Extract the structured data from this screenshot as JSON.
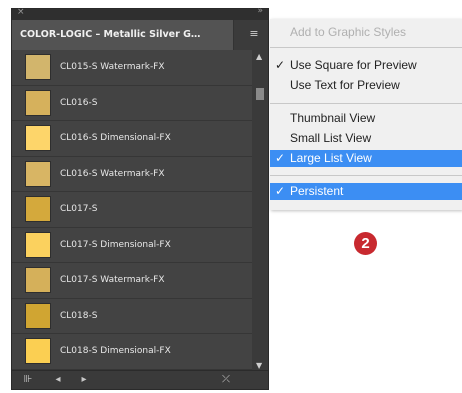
{
  "panel": {
    "close_glyph": "×",
    "collapse_glyph": "»",
    "tab_title": "COLOR-LOGIC – Metallic Silver G…",
    "menu_glyph": "≡",
    "items": [
      {
        "swatch_color": "#d2b56c",
        "label": "CL015-S   Watermark-FX"
      },
      {
        "swatch_color": "#d6b15c",
        "label": "CL016-S"
      },
      {
        "swatch_color": "#fdd56a",
        "label": "CL016-S   Dimensional-FX"
      },
      {
        "swatch_color": "#d8b564",
        "label": "CL016-S   Watermark-FX"
      },
      {
        "swatch_color": "#d4a93c",
        "label": "CL017-S"
      },
      {
        "swatch_color": "#fbd15e",
        "label": "CL017-S   Dimensional-FX"
      },
      {
        "swatch_color": "#d5b05a",
        "label": "CL017-S   Watermark-FX"
      },
      {
        "swatch_color": "#d0a532",
        "label": "CL018-S"
      },
      {
        "swatch_color": "#fbcf52",
        "label": "CL018-S   Dimensional-FX"
      }
    ],
    "footer": {
      "library_icon_glyph": "⊪",
      "prev_glyph": "◂",
      "next_glyph": "▸",
      "break_link_glyph": "⤫"
    },
    "scroll_up_glyph": "▲",
    "scroll_down_glyph": "▼"
  },
  "menu": {
    "add_to_graphic_styles": "Add to Graphic Styles",
    "use_square": "Use Square for Preview",
    "use_text": "Use Text for Preview",
    "thumbnail_view": "Thumbnail View",
    "small_list_view": "Small List View",
    "large_list_view": "Large List View",
    "persistent": "Persistent",
    "check_glyph": "✓"
  },
  "badge_number": "2",
  "colors": {
    "menu_highlight": "#3c8ef3",
    "badge": "#c8292f",
    "panel_bg": "#434343"
  }
}
